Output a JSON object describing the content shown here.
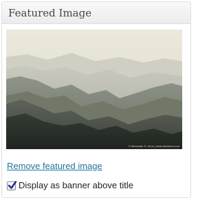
{
  "box": {
    "title": "Featured Image"
  },
  "image": {
    "watermark": "© Alexander S. Kunz | www.alexkunz.com",
    "colors": {
      "sky": "#e6e2d6",
      "far_mountains": "#b6b8ae",
      "mid_mountains": "#7f847a",
      "near_mountains": "#4f554c",
      "foreground": "#2a2f2a"
    }
  },
  "remove_link": {
    "label": "Remove featured image",
    "color": "#21759b"
  },
  "banner_option": {
    "label": "Display as banner above title",
    "checked": true
  }
}
